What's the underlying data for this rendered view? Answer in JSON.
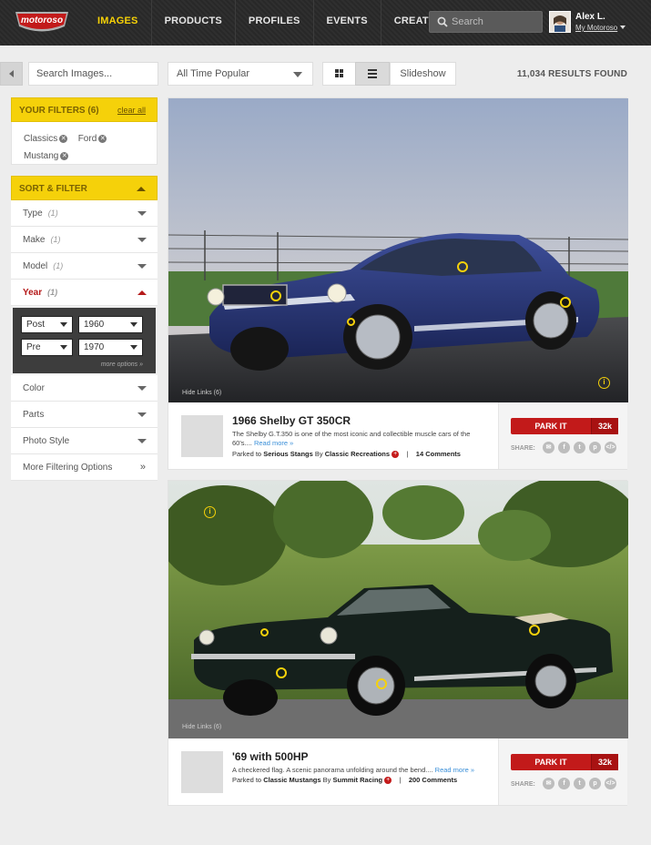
{
  "brand": {
    "logo_text": "motoroso",
    "accent": "#f5d10a",
    "red": "#c21a1a"
  },
  "nav": {
    "items": [
      "IMAGES",
      "PRODUCTS",
      "PROFILES",
      "EVENTS",
      "CREATE +"
    ],
    "active": "IMAGES",
    "search_placeholder": "Search"
  },
  "user": {
    "name": "Alex L.",
    "link": "My Motoroso"
  },
  "toolbar": {
    "search_placeholder": "Search Images...",
    "sort_value": "All Time Popular",
    "slideshow_label": "Slideshow",
    "results": "11,034 RESULTS FOUND"
  },
  "filters": {
    "title": "YOUR FILTERS (6)",
    "clear": "clear all",
    "chips": [
      "Classics",
      "Ford",
      "Mustang"
    ]
  },
  "sort_filter": {
    "title": "SORT & FILTER",
    "rows": [
      {
        "label": "Type",
        "count": "(1)"
      },
      {
        "label": "Make",
        "count": "(1)"
      },
      {
        "label": "Model",
        "count": "(1)"
      },
      {
        "label": "Year",
        "count": "(1)"
      }
    ],
    "year": {
      "post_label": "Post",
      "post_value": "1960",
      "pre_label": "Pre",
      "pre_value": "1970",
      "more": "more options »"
    },
    "rows2": [
      "Color",
      "Parts",
      "Photo Style"
    ],
    "more_filtering": "More Filtering Options",
    "more_arrow": "»"
  },
  "posts": [
    {
      "title": "1966 Shelby GT 350CR",
      "desc": "The Shelby G.T.350 is one of the most iconic and collectible muscle cars of the 60's....",
      "read_more": "Read more »",
      "parked_prefix": "Parked to",
      "board": "Serious Stangs",
      "by": "By",
      "author": "Classic Recreations",
      "comments": "14 Comments",
      "park_label": "PARK IT",
      "park_count": "32k",
      "share_label": "SHARE:",
      "hide_links": "Hide Links (6)"
    },
    {
      "title": "'69 with 500HP",
      "desc": "A checkered flag. A scenic panorama unfolding around the bend....",
      "read_more": "Read more »",
      "parked_prefix": "Parked to",
      "board": "Classic Mustangs",
      "by": "By",
      "author": "Summit Racing",
      "comments": "200 Comments",
      "park_label": "PARK IT",
      "park_count": "32k",
      "share_label": "SHARE:",
      "hide_links": "Hide Links (6)"
    }
  ]
}
